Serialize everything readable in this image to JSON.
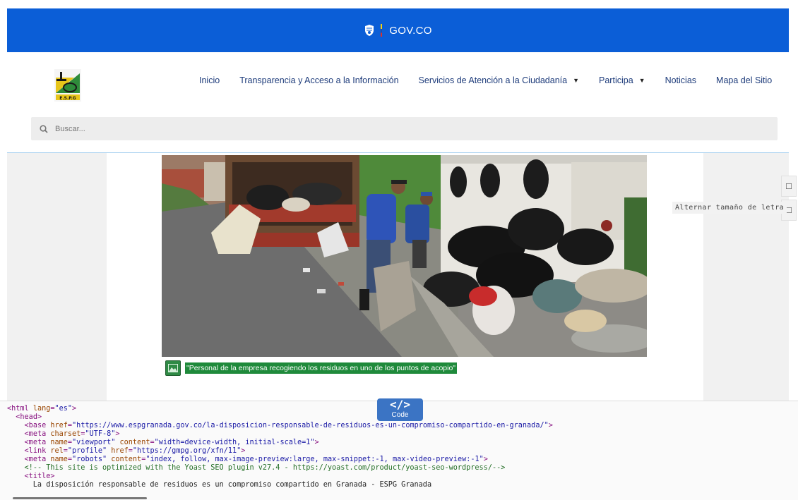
{
  "govbar": {
    "text": "GOV.CO"
  },
  "nav": {
    "items": [
      {
        "label": "Inicio",
        "dropdown": false
      },
      {
        "label": "Transparencia y Acceso a la Información",
        "dropdown": false
      },
      {
        "label": "Servicios de Atención a la Ciudadanía",
        "dropdown": true
      },
      {
        "label": "Participa",
        "dropdown": true
      },
      {
        "label": "Noticias",
        "dropdown": false
      },
      {
        "label": "Mapa del Sitio",
        "dropdown": false
      }
    ]
  },
  "search": {
    "placeholder": "Buscar..."
  },
  "caption": {
    "text": "\"Personal de la empresa recogiendo los residuos en uno de los puntos de acopio\""
  },
  "tools": {
    "font_toggle_label": "Alternar tamaño de letra",
    "button_glyph": "☐"
  },
  "code_tab": {
    "symbol": "</>",
    "label": "Code"
  },
  "code_lines": [
    [
      [
        "tag",
        "<html "
      ],
      [
        "attr",
        "lang"
      ],
      [
        "tag",
        "="
      ],
      [
        "val",
        "\"es\""
      ],
      [
        "tag",
        ">"
      ]
    ],
    [
      [
        "txt",
        "  "
      ],
      [
        "tag",
        "<head>"
      ]
    ],
    [
      [
        "txt",
        "    "
      ],
      [
        "tag",
        "<base "
      ],
      [
        "attr",
        "href"
      ],
      [
        "tag",
        "="
      ],
      [
        "val",
        "\"https://www.espgranada.gov.co/la-disposicion-responsable-de-residuos-es-un-compromiso-compartido-en-granada/\""
      ],
      [
        "tag",
        ">"
      ]
    ],
    [
      [
        "txt",
        "    "
      ],
      [
        "tag",
        "<meta "
      ],
      [
        "attr",
        "charset"
      ],
      [
        "tag",
        "="
      ],
      [
        "val",
        "\"UTF-8\""
      ],
      [
        "tag",
        ">"
      ]
    ],
    [
      [
        "txt",
        "    "
      ],
      [
        "tag",
        "<meta "
      ],
      [
        "attr",
        "name"
      ],
      [
        "tag",
        "="
      ],
      [
        "val",
        "\"viewport\""
      ],
      [
        "attr",
        " content"
      ],
      [
        "tag",
        "="
      ],
      [
        "val",
        "\"width=device-width, initial-scale=1\""
      ],
      [
        "tag",
        ">"
      ]
    ],
    [
      [
        "txt",
        "    "
      ],
      [
        "tag",
        "<link "
      ],
      [
        "attr",
        "rel"
      ],
      [
        "tag",
        "="
      ],
      [
        "val",
        "\"profile\""
      ],
      [
        "attr",
        " href"
      ],
      [
        "tag",
        "="
      ],
      [
        "val",
        "\"https://gmpg.org/xfn/11\""
      ],
      [
        "tag",
        ">"
      ]
    ],
    [
      [
        "txt",
        "    "
      ],
      [
        "tag",
        "<meta "
      ],
      [
        "attr",
        "name"
      ],
      [
        "tag",
        "="
      ],
      [
        "val",
        "\"robots\""
      ],
      [
        "attr",
        " content"
      ],
      [
        "tag",
        "="
      ],
      [
        "val",
        "\"index, follow, max-image-preview:large, max-snippet:-1, max-video-preview:-1\""
      ],
      [
        "tag",
        ">"
      ]
    ],
    [
      [
        "txt",
        "    "
      ],
      [
        "com",
        "<!-- This site is optimized with the Yoast SEO plugin v27.4 - https://yoast.com/product/yoast-seo-wordpress/-->"
      ]
    ],
    [
      [
        "txt",
        "    "
      ],
      [
        "tag",
        "<title>"
      ]
    ],
    [
      [
        "txt",
        "      La disposición responsable de residuos es un compromiso compartido en Granada - ESPG Granada"
      ]
    ]
  ],
  "colors": {
    "gov_blue": "#0b5ed7",
    "nav_text": "#1d3b7a",
    "caption_green": "#1f8a3b",
    "code_tab": "#3b74c4"
  }
}
